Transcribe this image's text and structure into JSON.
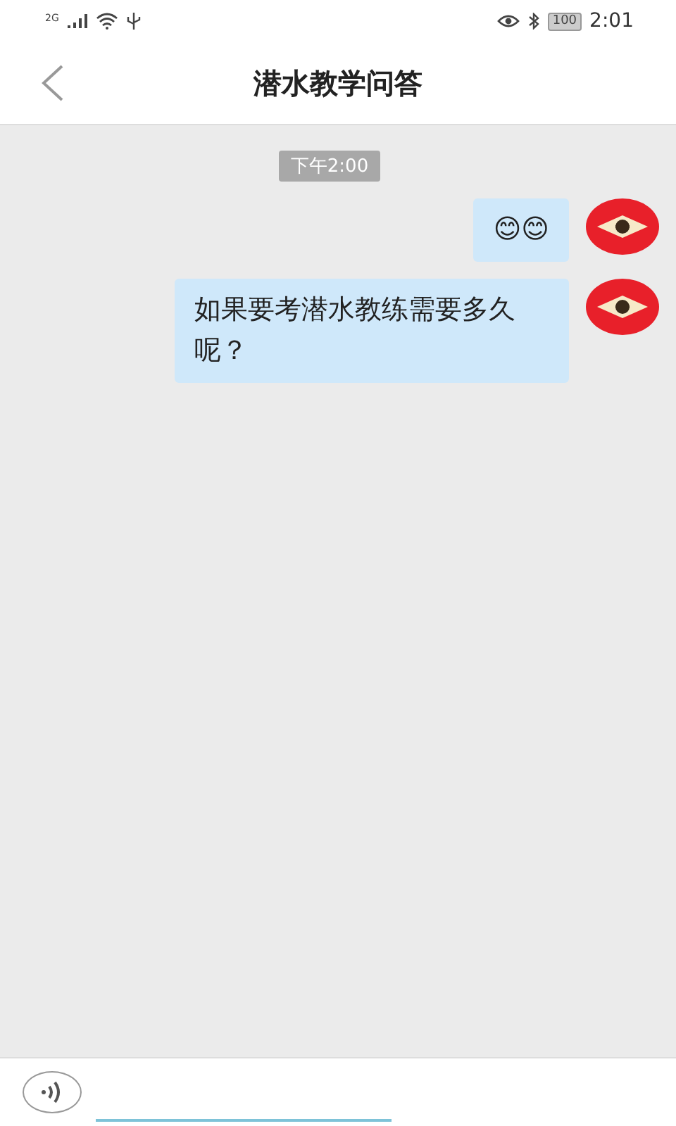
{
  "status_bar": {
    "network": "2G",
    "battery": "100",
    "time": "2:01"
  },
  "header": {
    "title": "潜水教学问答"
  },
  "chat": {
    "timestamp": "下午2:00",
    "messages": [
      {
        "kind": "sent",
        "text": "😊😊"
      },
      {
        "kind": "sent",
        "text": "如果要考潜水教练需要多久呢？"
      }
    ]
  }
}
